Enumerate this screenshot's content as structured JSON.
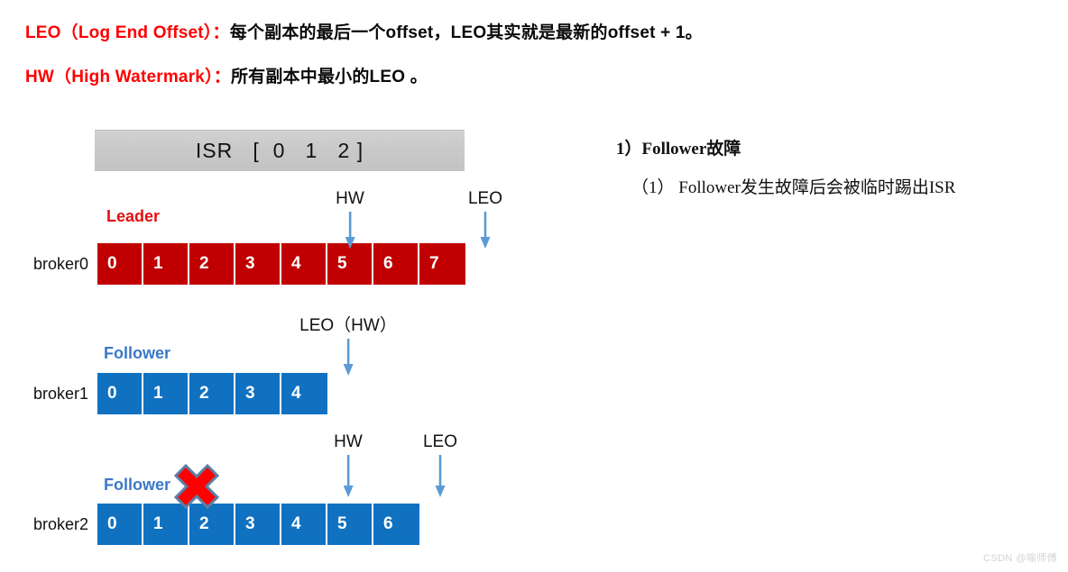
{
  "definitions": [
    {
      "id": "leo",
      "term": "LEO（Log End Offset）",
      "colon": "：",
      "body": "每个副本的最后一个offset，LEO其实就是最新的offset + 1。"
    },
    {
      "id": "hw",
      "term": "HW（High Watermark）",
      "colon": "：",
      "body": "所有副本中最小的LEO 。"
    }
  ],
  "isr": {
    "text": "ISR   [  0   1   2 ]",
    "label": "ISR",
    "members": [
      0,
      1,
      2
    ]
  },
  "brokers": [
    {
      "name": "broker0",
      "role": "Leader",
      "role_color": "#E01010",
      "cell_color": "#C00000",
      "offsets": [
        "0",
        "1",
        "2",
        "3",
        "4",
        "5",
        "6",
        "7"
      ],
      "markers": [
        {
          "label": "HW",
          "target_index": 5
        },
        {
          "label": "LEO",
          "target_index": 8
        }
      ]
    },
    {
      "name": "broker1",
      "role": "Follower",
      "role_color": "#3B78C8",
      "cell_color": "#1071C1",
      "offsets": [
        "0",
        "1",
        "2",
        "3",
        "4"
      ],
      "markers": [
        {
          "label": "LEO（HW）",
          "target_index": 5
        }
      ]
    },
    {
      "name": "broker2",
      "role": "Follower",
      "role_color": "#3B78C8",
      "cell_color": "#1071C1",
      "offsets": [
        "0",
        "1",
        "2",
        "3",
        "4",
        "5",
        "6"
      ],
      "failed": true,
      "markers": [
        {
          "label": "HW",
          "target_index": 5
        },
        {
          "label": "LEO",
          "target_index": 7
        }
      ]
    }
  ],
  "notes": {
    "title": "1）Follower故障",
    "item1": "（1） Follower发生故障后会被临时踢出ISR"
  },
  "watermark": "CSDN @喻师傅",
  "colors": {
    "accent_red": "#FF0000",
    "leader_red": "#C00000",
    "follower_blue": "#1071C1",
    "arrow_blue": "#5B9BD5",
    "isr_gray": "#C9C9C9"
  }
}
